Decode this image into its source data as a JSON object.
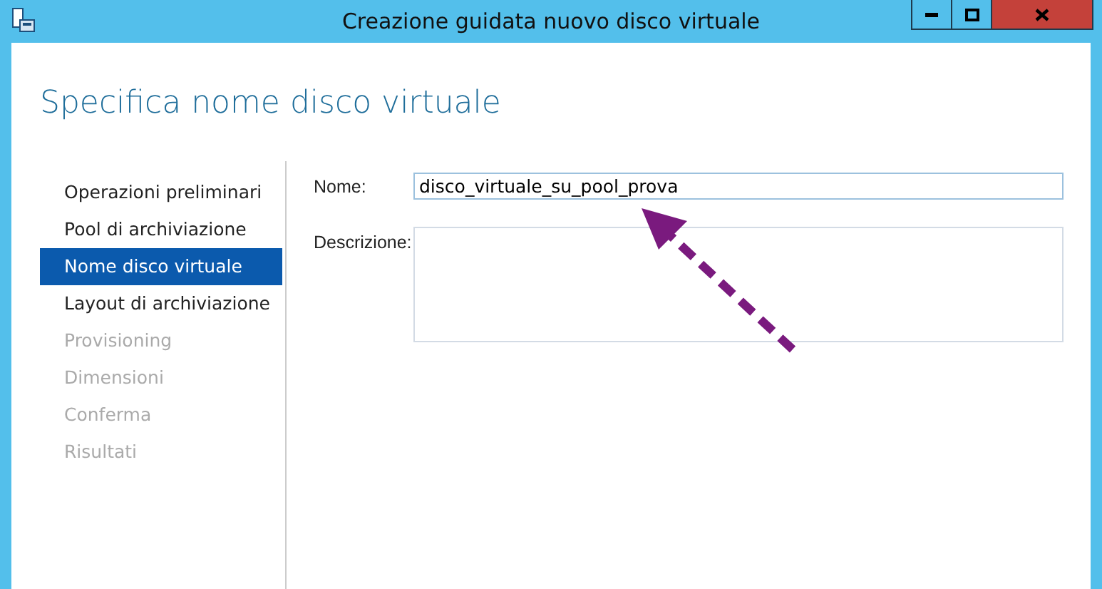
{
  "window": {
    "title": "Creazione guidata nuovo disco virtuale"
  },
  "heading": "Specifica nome disco virtuale",
  "steps": [
    {
      "label": "Operazioni preliminari",
      "selected": false,
      "disabled": false
    },
    {
      "label": "Pool di archiviazione",
      "selected": false,
      "disabled": false
    },
    {
      "label": "Nome disco virtuale",
      "selected": true,
      "disabled": false
    },
    {
      "label": "Layout di archiviazione",
      "selected": false,
      "disabled": false
    },
    {
      "label": "Provisioning",
      "selected": false,
      "disabled": true
    },
    {
      "label": "Dimensioni",
      "selected": false,
      "disabled": true
    },
    {
      "label": "Conferma",
      "selected": false,
      "disabled": true
    },
    {
      "label": "Risultati",
      "selected": false,
      "disabled": true
    }
  ],
  "fields": [
    {
      "label": "Nome:",
      "kind": "text",
      "value": "disco_virtuale_su_pool_prova"
    },
    {
      "label": "Descrizione:",
      "kind": "textarea"
    }
  ]
}
